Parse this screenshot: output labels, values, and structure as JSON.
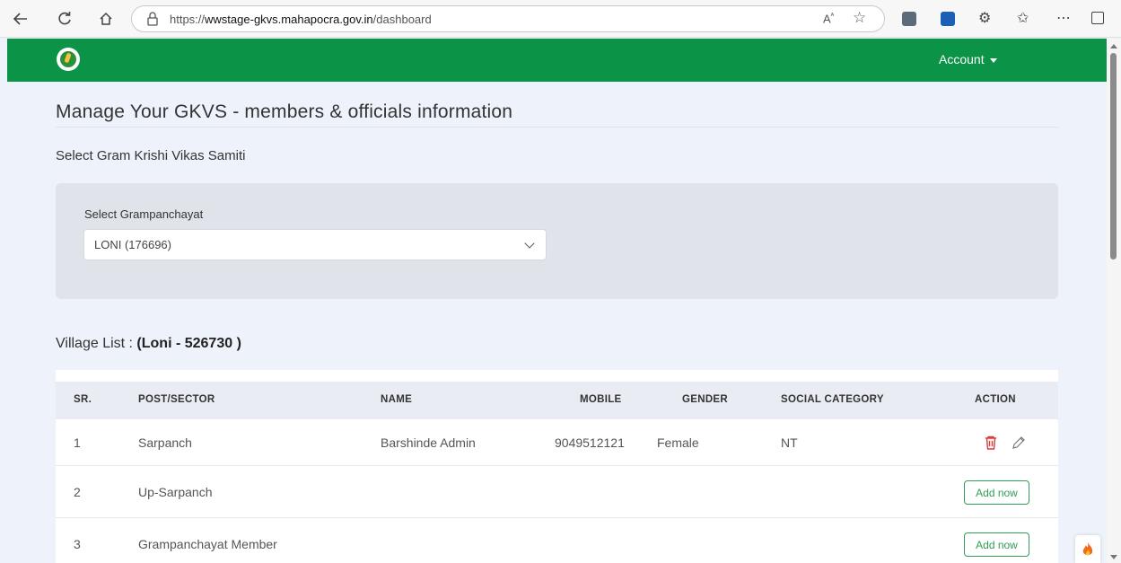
{
  "browser": {
    "url_prefix": "https://",
    "url_domain": "wwstage-gkvs.mahapocra.gov.in",
    "url_path": "/dashboard"
  },
  "header": {
    "account_label": "Account",
    "colors": {
      "brand_green": "#0b9447"
    }
  },
  "page": {
    "title": "Manage Your GKVS - members & officials information",
    "section_label": "Select Gram Krishi Vikas Samiti",
    "select_label": "Select Grampanchayat",
    "select_value": "LONI (176696)",
    "village_prefix": "Village List : ",
    "village_name": "(Loni - 526730 )"
  },
  "table": {
    "headers": [
      "SR.",
      "POST/SECTOR",
      "NAME",
      "MOBILE",
      "GENDER",
      "SOCIAL CATEGORY",
      "ACTION"
    ],
    "rows": [
      {
        "sr": "1",
        "post": "Sarpanch",
        "name": "Barshinde Admin",
        "mobile": "9049512121",
        "gender": "Female",
        "category": "NT",
        "action": "edit-delete"
      },
      {
        "sr": "2",
        "post": "Up-Sarpanch",
        "name": "",
        "mobile": "",
        "gender": "",
        "category": "",
        "action": "Add now"
      },
      {
        "sr": "3",
        "post": "Grampanchayat Member",
        "name": "",
        "mobile": "",
        "gender": "",
        "category": "",
        "action": "Add now"
      }
    ]
  },
  "icons": [
    "back-icon",
    "refresh-icon",
    "home-icon",
    "lock-icon",
    "read-aloud-icon",
    "favorite-icon",
    "extension-icon",
    "favorites-bar-icon",
    "more-icon",
    "sidebar-icon",
    "delete-icon",
    "edit-icon",
    "fire-icon"
  ]
}
